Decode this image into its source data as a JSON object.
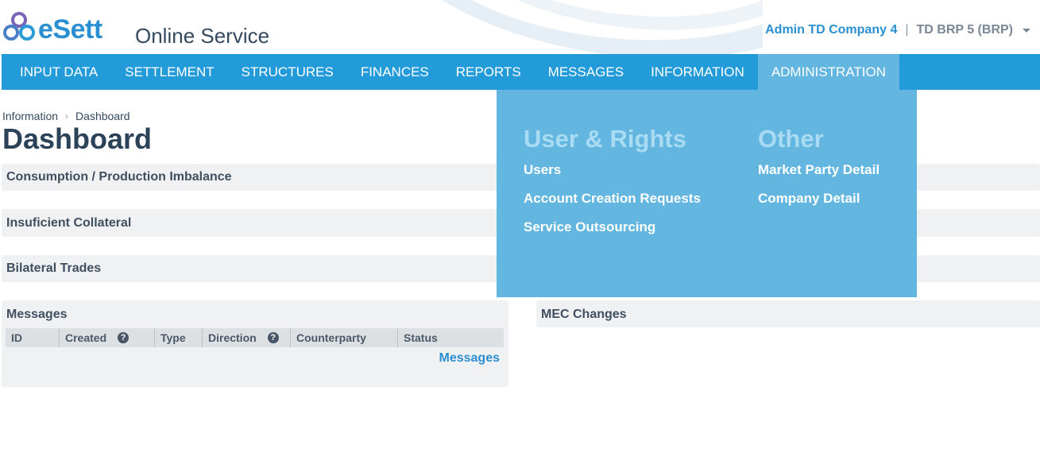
{
  "header": {
    "brand": "eSett",
    "app_title": "Online Service",
    "user_name": "Admin TD Company 4",
    "separator": "|",
    "role": "TD BRP 5 (BRP)"
  },
  "nav": {
    "items": [
      "INPUT DATA",
      "SETTLEMENT",
      "STRUCTURES",
      "FINANCES",
      "REPORTS",
      "MESSAGES",
      "INFORMATION",
      "ADMINISTRATION"
    ],
    "active": "ADMINISTRATION"
  },
  "dropdown": {
    "col1": {
      "heading": "User & Rights",
      "links": [
        "Users",
        "Account Creation Requests",
        "Service Outsourcing"
      ]
    },
    "col2": {
      "heading": "Other",
      "links": [
        "Market Party Detail",
        "Company Detail"
      ]
    }
  },
  "breadcrumb": {
    "parent": "Information",
    "current": "Dashboard"
  },
  "page_title": "Dashboard",
  "panels": {
    "imbalance": "Consumption / Production Imbalance",
    "collateral": "Insuficient Collateral",
    "bilateral": "Bilateral Trades",
    "messages": "Messages",
    "mec": "MEC Changes"
  },
  "messages_table": {
    "columns": [
      "ID",
      "Created",
      "Type",
      "Direction",
      "Counterparty",
      "Status"
    ],
    "link": "Messages"
  },
  "colors": {
    "primary": "#239bd8",
    "dropdown": "#62b6df",
    "panel": "#f0f1f3"
  }
}
